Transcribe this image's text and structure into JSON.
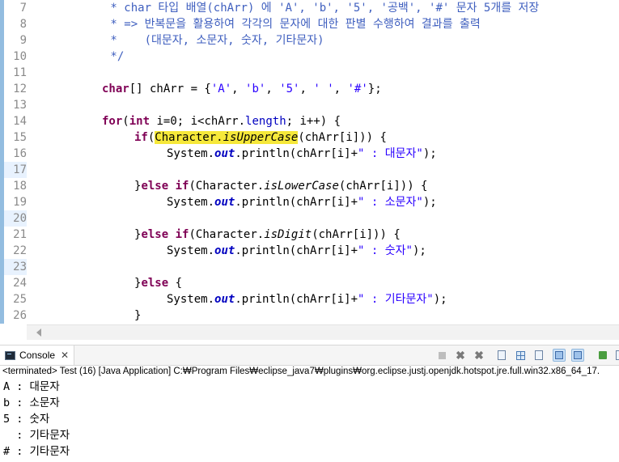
{
  "editor": {
    "line_numbers": [
      "7",
      "8",
      "9",
      "10",
      "11",
      "12",
      "13",
      "14",
      "15",
      "16",
      "17",
      "18",
      "19",
      "20",
      "21",
      "22",
      "23",
      "24",
      "25",
      "26"
    ],
    "comment_7": " * char 타입 배열(chArr) 에 'A', 'b', '5', '공백', '#' 문자 5개를 저장",
    "comment_8": " * => 반복문을 활용하여 각각의 문자에 대한 판별 수행하여 결과를 출력",
    "comment_9": " *    (대문자, 소문자, 숫자, 기타문자)",
    "comment_10": " */",
    "kw_char": "char",
    "l12_decl": "[] chArr = {",
    "l12_a": "'A'",
    "l12_b": "'b'",
    "l12_5": "'5'",
    "l12_sp": "' '",
    "l12_hash": "'#'",
    "l12_end": "};",
    "comma": ", ",
    "kw_for": "for",
    "kw_int": "int",
    "l14_a": "(",
    "l14_b": " i=0; i<chArr.",
    "l14_length": "length",
    "l14_c": "; i++) {",
    "kw_if": "if",
    "kw_else": "else",
    "kw_else_if_brace": "}",
    "class_character": "Character.",
    "m_isUpper": "isUpperCase",
    "m_isLower": "isLowerCase",
    "m_isDigit": "isDigit",
    "arg": "(chArr[i])) {",
    "sys": "System.",
    "out": "out",
    "println": ".println(chArr[i]+",
    "str_upper": "\" : 대문자\"",
    "str_lower": "\" : 소문자\"",
    "str_digit": "\" : 숫자\"",
    "str_other": "\" : 기타문자\"",
    "stmt_end": ");",
    "else_open": " {",
    "close_brace": "}"
  },
  "console": {
    "tab_label": "Console",
    "tab_close": "✕",
    "status": "<terminated> Test (16) [Java Application] C:₩Program Files₩eclipse_java7₩plugins₩org.eclipse.justj.openjdk.hotspot.jre.full.win32.x86_64_17.",
    "output": [
      "A : 대문자",
      "b : 소문자",
      "5 : 숫자",
      "  : 기타문자",
      "# : 기타문자"
    ]
  }
}
